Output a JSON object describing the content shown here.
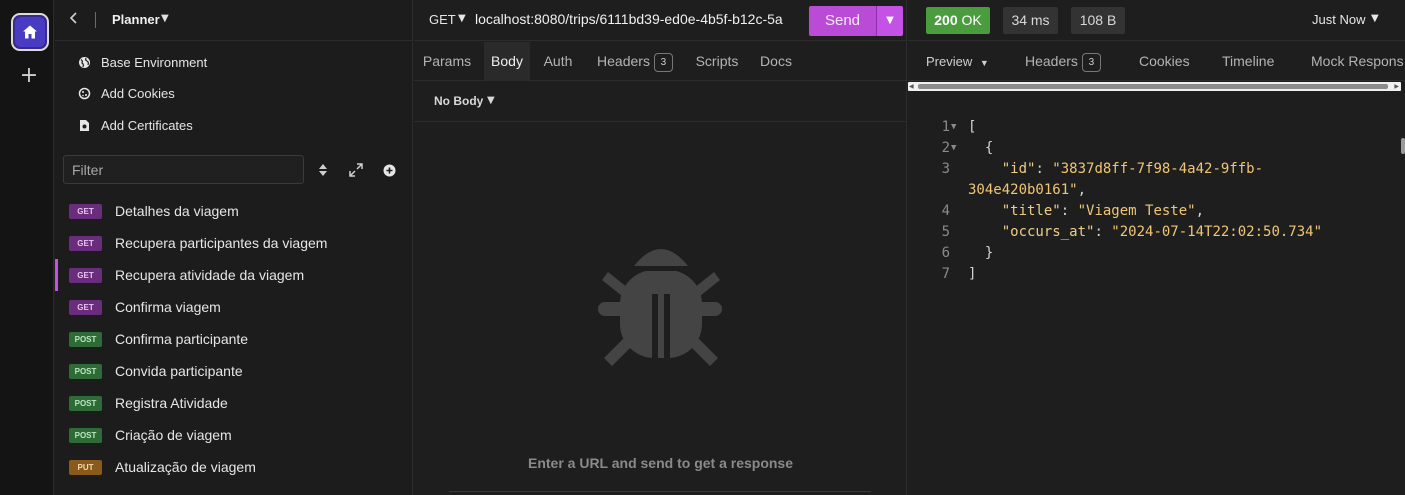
{
  "sidebar": {
    "project": "Planner",
    "links": [
      {
        "label": "Base Environment",
        "icon": "globe-icon"
      },
      {
        "label": "Add Cookies",
        "icon": "cookie-icon"
      },
      {
        "label": "Add Certificates",
        "icon": "certificate-icon"
      }
    ],
    "filter_placeholder": "Filter",
    "requests": [
      {
        "method": "GET",
        "name": "Detalhes da viagem",
        "active": false
      },
      {
        "method": "GET",
        "name": "Recupera participantes da viagem",
        "active": false
      },
      {
        "method": "GET",
        "name": "Recupera atividade da viagem",
        "active": true
      },
      {
        "method": "GET",
        "name": "Confirma viagem",
        "active": false
      },
      {
        "method": "POST",
        "name": "Confirma participante",
        "active": false
      },
      {
        "method": "POST",
        "name": "Convida participante",
        "active": false
      },
      {
        "method": "POST",
        "name": "Registra Atividade",
        "active": false
      },
      {
        "method": "POST",
        "name": "Criação de viagem",
        "active": false
      },
      {
        "method": "PUT",
        "name": "Atualização de viagem",
        "active": false
      }
    ]
  },
  "request": {
    "method": "GET",
    "url": "localhost:8080/trips/6111bd39-ed0e-4b5f-b12c-5a",
    "send_label": "Send",
    "tabs": {
      "params": "Params",
      "body": "Body",
      "auth": "Auth",
      "headers": "Headers",
      "headers_count": "3",
      "scripts": "Scripts",
      "docs": "Docs"
    },
    "body_type": "No Body",
    "empty_message": "Enter a URL and send to get a response"
  },
  "response": {
    "status_code": "200",
    "status_text": "OK",
    "time": "34 ms",
    "size": "108 B",
    "history": "Just Now",
    "tabs": {
      "preview": "Preview",
      "headers": "Headers",
      "headers_count": "3",
      "cookies": "Cookies",
      "timeline": "Timeline",
      "mock": "Mock Respons"
    },
    "lines": [
      {
        "n": "1",
        "fold": true
      },
      {
        "n": "2",
        "fold": true
      },
      {
        "n": "3",
        "fold": false
      },
      {
        "n": "4",
        "fold": false
      },
      {
        "n": "5",
        "fold": false
      },
      {
        "n": "6",
        "fold": false
      },
      {
        "n": "7",
        "fold": false
      }
    ],
    "json": {
      "id_key": "\"id\"",
      "id_value_a": "\"3837d8ff-7f98-4a42-9ffb-",
      "id_value_b": "304e420b0161\"",
      "title_key": "\"title\"",
      "title_value": "\"Viagem Teste\"",
      "occurs_key": "\"occurs_at\"",
      "occurs_value": "\"2024-07-14T22:02:50.734\""
    }
  },
  "colors": {
    "accent": "#c452e6",
    "status_ok": "#4a9c3f",
    "get": "#6c2c7e",
    "post": "#2f6b36",
    "put": "#8a5a1c"
  }
}
